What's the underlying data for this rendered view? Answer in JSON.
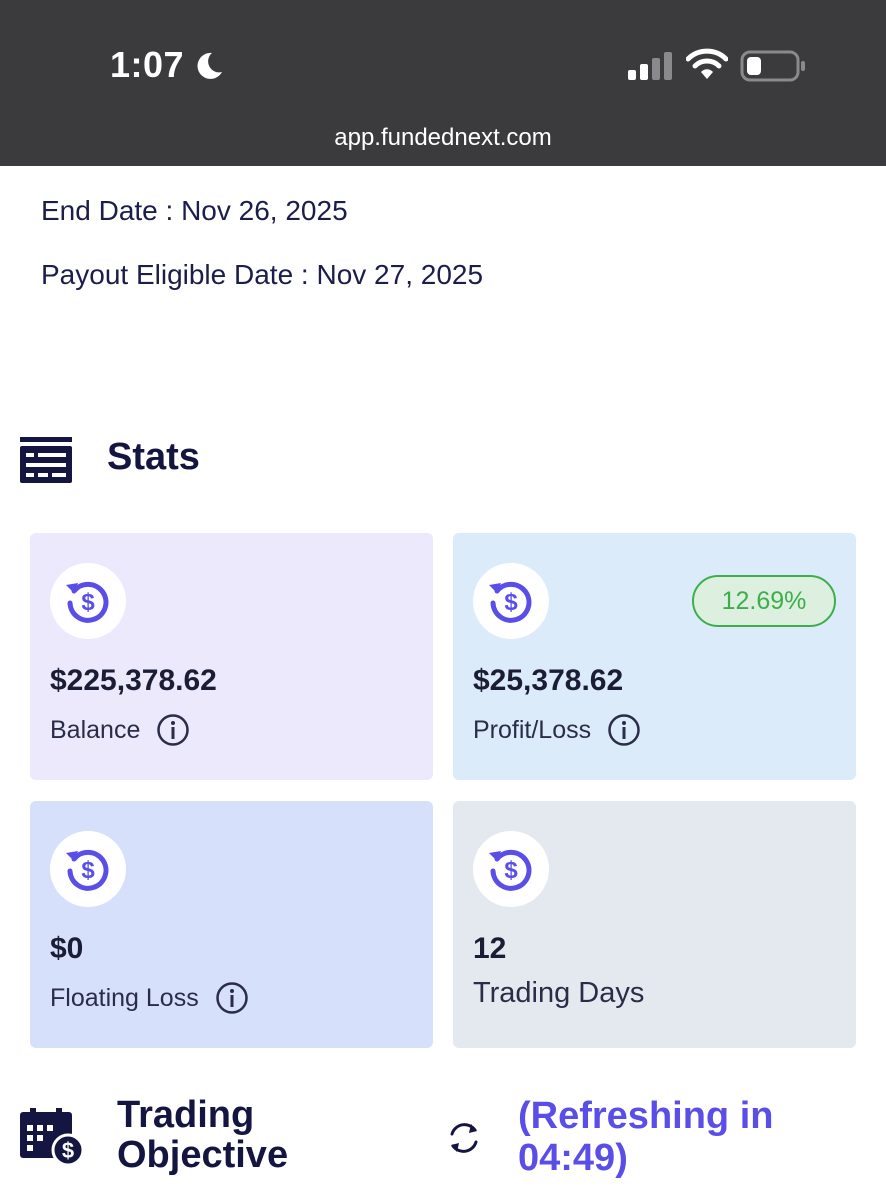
{
  "status_bar": {
    "time": "1:07",
    "url": "app.fundednext.com"
  },
  "dates": {
    "end_date": "End Date : Nov 26, 2025",
    "payout_eligible_date": "Payout Eligible Date : Nov 27, 2025"
  },
  "stats": {
    "title": "Stats",
    "cards": [
      {
        "value": "$225,378.62",
        "label": "Balance",
        "bg": "#ebe9fb"
      },
      {
        "value": "$25,378.62",
        "label": "Profit/Loss",
        "badge": "12.69%",
        "bg": "#dbebfa"
      },
      {
        "value": "$0",
        "label": "Floating Loss",
        "bg": "#d6e0fb"
      },
      {
        "value": "12",
        "label": "Trading Days",
        "bg": "#e3e9ee"
      }
    ]
  },
  "trading_objective": {
    "title_line1": "Trading",
    "title_line2": "Objective",
    "refresh_line1": "(Refreshing in",
    "refresh_line2": "04:49)"
  },
  "colors": {
    "accent": "#5a4ee8",
    "navy": "#141540",
    "badge_green": "#3dae4a"
  },
  "icons": [
    "moon-icon",
    "signal-icon",
    "wifi-icon",
    "battery-icon",
    "stats-icon",
    "dollar-refresh-icon",
    "info-icon",
    "calendar-dollar-icon",
    "refresh-icon"
  ]
}
